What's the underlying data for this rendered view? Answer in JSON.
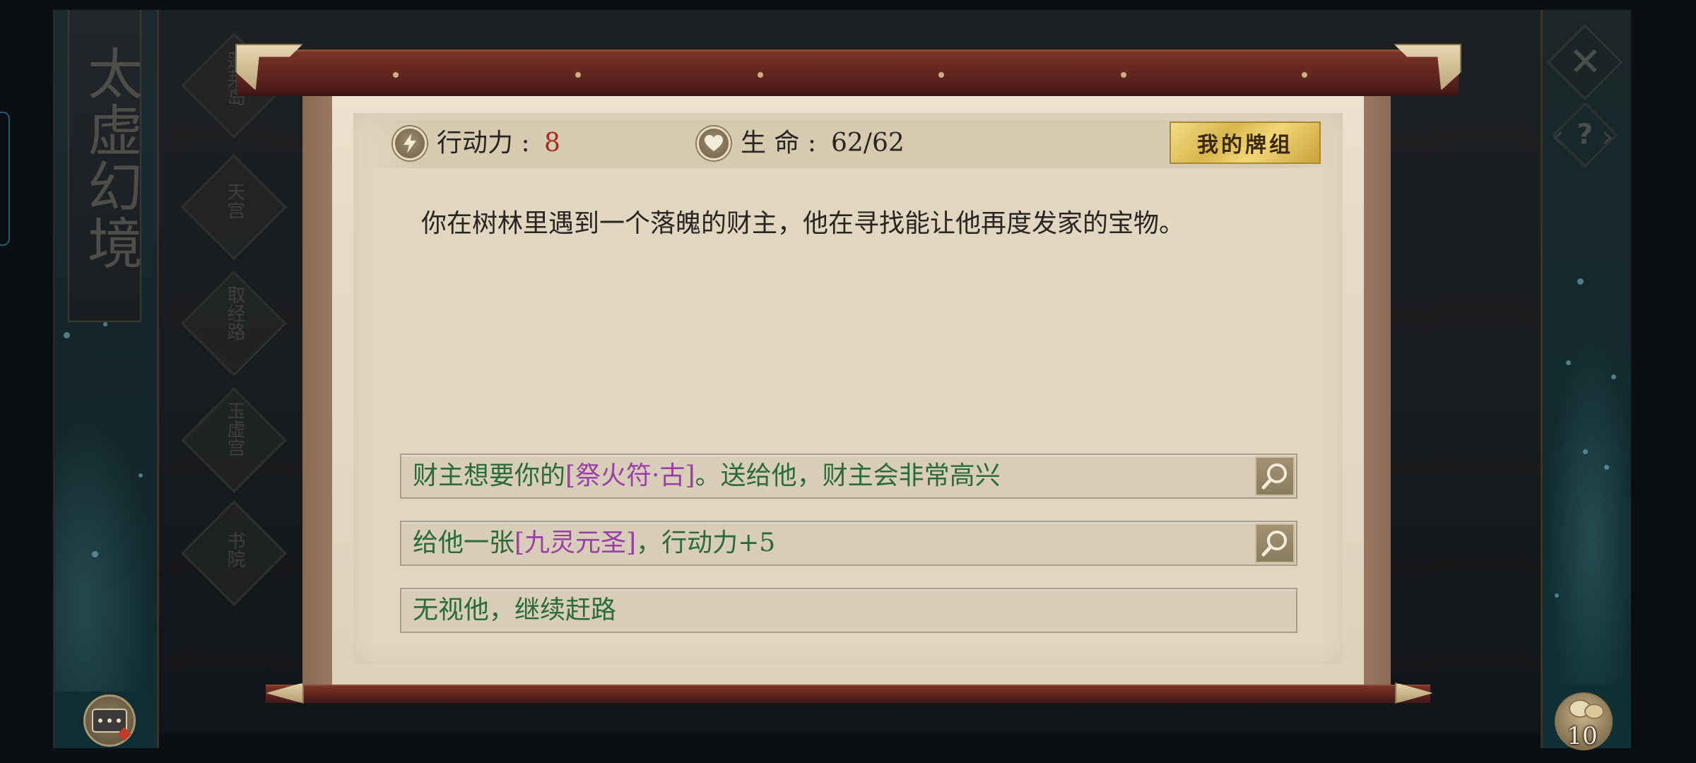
{
  "game": {
    "title_banner": "太虚幻境",
    "side_nodes": [
      "蓬莱岛",
      "天宫",
      "取经路",
      "玉虚宫",
      "书院"
    ]
  },
  "status": {
    "energy_label": "行动力 : ",
    "energy_value": "8",
    "life_label": "生 命 : ",
    "life_value": "62/62",
    "deck_button": "我的牌组"
  },
  "event": {
    "story": "你在树林里遇到一个落魄的财主，他在寻找能让他再度发家的宝物。",
    "choices": [
      {
        "pre": "财主想要你的",
        "item": "[祭火符·古]",
        "post": "。送给他，财主会非常高兴",
        "inspectable": true
      },
      {
        "pre": "给他一张",
        "item": "[九灵元圣]",
        "post": "，行动力+5",
        "inspectable": true
      },
      {
        "pre": "无视他，继续赶路",
        "item": "",
        "post": "",
        "inspectable": false
      }
    ]
  },
  "hud": {
    "coin_count": "10"
  },
  "colors": {
    "energy_value": "#a8291d",
    "choice_text": "#2a6a3b",
    "item_text": "#9a3fa6",
    "deck_button": "#e0c05a"
  },
  "icons": [
    "lightning-icon",
    "heart-icon",
    "magnifier-icon",
    "close-icon",
    "help-icon",
    "chat-icon",
    "coin-bag-icon"
  ]
}
